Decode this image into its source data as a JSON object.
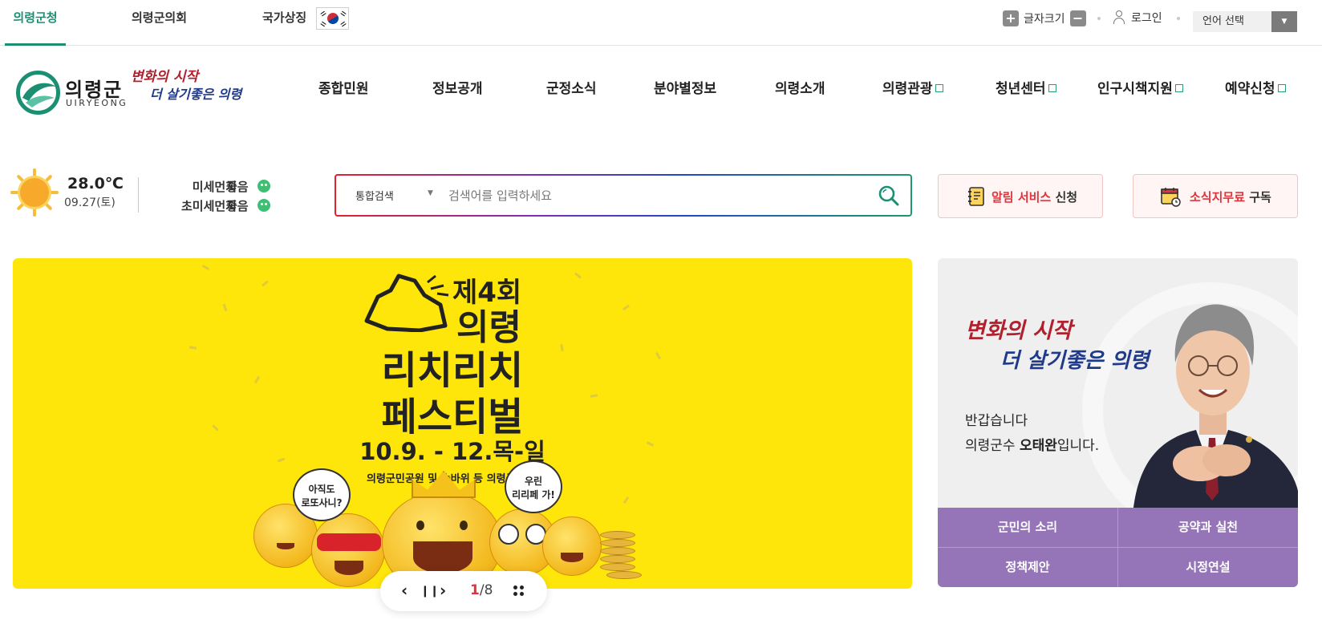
{
  "top_tabs": [
    {
      "label": "의령군청",
      "active": true
    },
    {
      "label": "의령군의회",
      "active": false
    },
    {
      "label": "국가상징",
      "active": false
    }
  ],
  "utility": {
    "font_size_label": "글자크기",
    "font_increase": "+",
    "font_decrease": "−",
    "login_label": "로그인",
    "language_select": "언어 선택"
  },
  "logo": {
    "name": "의령군",
    "english": "UIRYEONG",
    "slogan_line1": "변화의 시작",
    "slogan_line2": "더 살기좋은 의령"
  },
  "gnb": [
    {
      "label": "종합민원",
      "external": false
    },
    {
      "label": "정보공개",
      "external": false
    },
    {
      "label": "군정소식",
      "external": false
    },
    {
      "label": "분야별정보",
      "external": false
    },
    {
      "label": "의령소개",
      "external": false
    },
    {
      "label": "의령관광",
      "external": true
    },
    {
      "label": "청년센터",
      "external": true
    },
    {
      "label": "인구시책지원",
      "external": true
    },
    {
      "label": "예약신청",
      "external": true
    }
  ],
  "weather": {
    "icon": "sun-icon",
    "temperature": "28.0℃",
    "date": "09.27(토)",
    "fine_dust_label": "미세먼지",
    "fine_dust_value": "좋음",
    "ultrafine_dust_label": "초미세먼지",
    "ultrafine_dust_value": "좋음",
    "good_color": "#3fbf74"
  },
  "search": {
    "scope": "통합검색",
    "placeholder": "검색어를 입력하세요",
    "value": ""
  },
  "service_buttons": [
    {
      "highlight": "알림 서비스",
      "suffix": "신청",
      "icon": "notebook-icon"
    },
    {
      "highlight": "소식지무료",
      "suffix": "구독",
      "icon": "calendar-icon"
    }
  ],
  "banner": {
    "edition": "제4회",
    "title_line1": "의령",
    "title_line2": "리치리치",
    "title_line3": "페스티벌",
    "dates": "10.9. - 12.목-일",
    "venue": "의령군민공원 및 솥바위 등 의령군 일원",
    "bubble_left": "아직도\n로또사니?",
    "bubble_right": "우린\n리리페 가!",
    "background_color": "#ffe60a"
  },
  "pager": {
    "prev": "‹",
    "pause": "❙❙",
    "next": "›",
    "current": "1",
    "total": "/8"
  },
  "mayor": {
    "slogan_line1": "변화의 시작",
    "slogan_line2": "더 살기좋은 의령",
    "greeting_line1": "반갑습니다",
    "greeting_prefix": "의령군수 ",
    "greeting_name": "오태완",
    "greeting_suffix": "입니다.",
    "links": [
      "군민의 소리",
      "공약과 실천",
      "정책제안",
      "시정연설"
    ],
    "link_bg_color": "#9575b8"
  },
  "colors": {
    "brand_green": "#1c8f73",
    "accent_red": "#e0343c"
  }
}
